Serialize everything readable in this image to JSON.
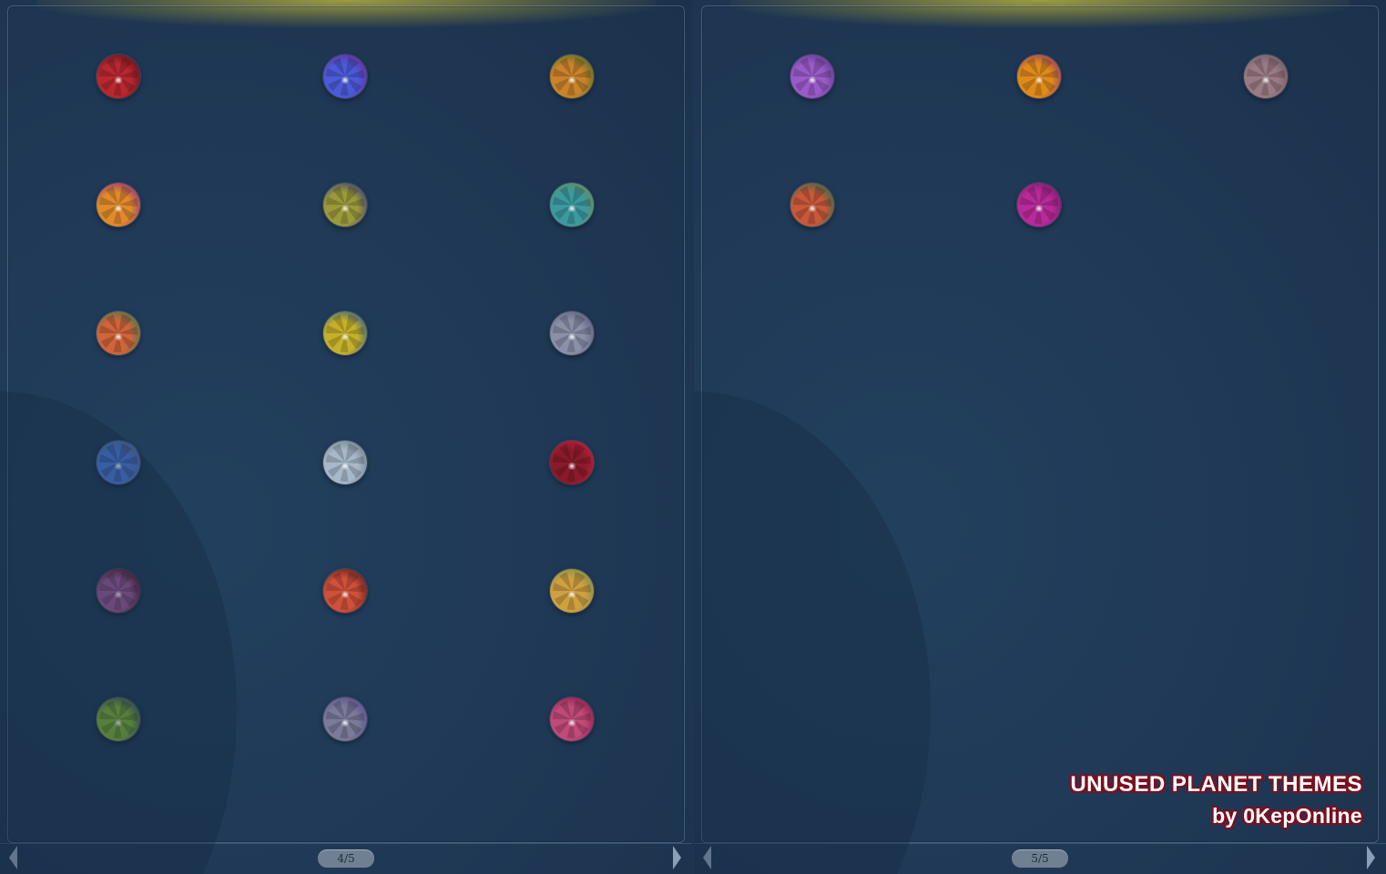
{
  "left_panel": {
    "page_indicator": "4/5",
    "planets": [
      {
        "theme": "crimson",
        "core": "#b8282e",
        "rim": "#5c1020"
      },
      {
        "theme": "violet-blue",
        "core": "#4a5ad8",
        "rim": "#6a2a90"
      },
      {
        "theme": "amber-green",
        "core": "#c9832a",
        "rim": "#4e6a2a"
      },
      {
        "theme": "orange-magenta",
        "core": "#e08a2a",
        "rim": "#8a2a8a"
      },
      {
        "theme": "olive-indigo",
        "core": "#9a9a3a",
        "rim": "#3a3a7a"
      },
      {
        "theme": "teal-sand",
        "core": "#3a9aa0",
        "rim": "#6a8a5a"
      },
      {
        "theme": "coral-green",
        "core": "#d0643a",
        "rim": "#3a7a4a"
      },
      {
        "theme": "gold-blue",
        "core": "#c4b02a",
        "rim": "#2a5a8a"
      },
      {
        "theme": "slate-lilac",
        "core": "#8a90a8",
        "rim": "#5a5a7a"
      },
      {
        "theme": "azure",
        "core": "#4a7ad8",
        "rim": "#5a6a9a"
      },
      {
        "theme": "ice-grey",
        "core": "#a8b8c8",
        "rim": "#6a7a8a"
      },
      {
        "theme": "blood-red",
        "core": "#8a1a2a",
        "rim": "#c02040"
      },
      {
        "theme": "dark-orchid",
        "core": "#9a5a9a",
        "rim": "#4a1020"
      },
      {
        "theme": "ember",
        "core": "#d0503a",
        "rim": "#5a1a1a"
      },
      {
        "theme": "honey-sage",
        "core": "#d0a040",
        "rim": "#7a8a4a"
      },
      {
        "theme": "lime-slate",
        "core": "#7aae3a",
        "rim": "#3a4a6a"
      },
      {
        "theme": "dusk-rose",
        "core": "#7a7a9a",
        "rim": "#5a4a8a"
      },
      {
        "theme": "rose-magenta",
        "core": "#c04a7a",
        "rim": "#8a1a4a"
      }
    ]
  },
  "right_panel": {
    "page_indicator": "5/5",
    "planets": [
      {
        "theme": "lavender",
        "core": "#9a5ac8",
        "rim": "#5a3a8a"
      },
      {
        "theme": "tangerine",
        "core": "#e08a1a",
        "rim": "#8a3a6a"
      },
      {
        "theme": "mauve-stone",
        "core": "#9a7a84",
        "rim": "#6a5a62"
      },
      {
        "theme": "terracotta-jade",
        "core": "#c8583a",
        "rim": "#2a6a4a"
      },
      {
        "theme": "fuchsia",
        "core": "#b82a9a",
        "rim": "#7a1a6a"
      }
    ]
  },
  "credits": {
    "title": "UNUSED PLANET THEMES",
    "byline": "by 0KepOnline"
  }
}
